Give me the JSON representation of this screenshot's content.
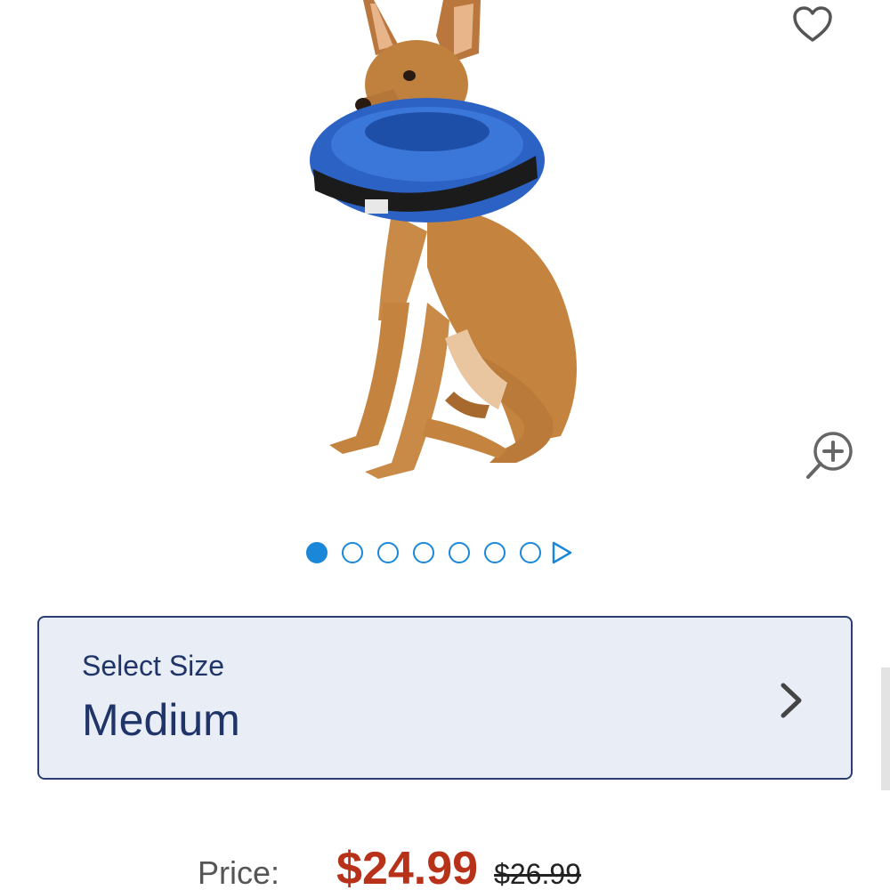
{
  "product": {
    "image_alt": "Dog wearing a blue inflatable cone collar",
    "favorite_icon": "heart-outline-icon",
    "zoom_icon": "zoom-in-icon"
  },
  "carousel": {
    "total": 7,
    "active_index": 0,
    "next_icon": "play-triangle-icon"
  },
  "size_selector": {
    "label": "Select Size",
    "value": "Medium",
    "chevron_icon": "chevron-right-icon"
  },
  "price": {
    "label": "Price:",
    "current": "$24.99",
    "original": "$26.99"
  },
  "colors": {
    "accent": "#1a87d8",
    "navy": "#1f3569",
    "price_red": "#b8321a",
    "selector_bg": "#e9edf5"
  }
}
